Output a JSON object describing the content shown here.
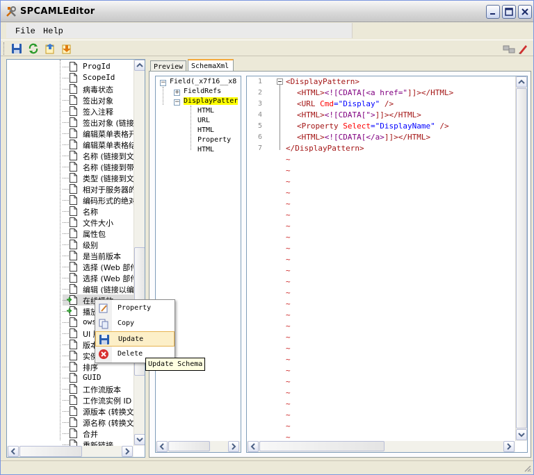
{
  "window": {
    "title": "SPCAMLEditor"
  },
  "menu": {
    "file": "File",
    "help": "Help"
  },
  "left_tree": {
    "items": [
      "ProgId",
      "ScopeId",
      "病毒状态",
      "签出对象",
      "签入注释",
      "签出对象 (链接到",
      "编辑菜单表格开",
      "编辑菜单表格结",
      "名称 (链接到文",
      "名称 (链接到带",
      "类型 (链接到文",
      "相对于服务器的",
      "编码形式的绝对",
      "名称",
      "文件大小",
      "属性包",
      "级别",
      "是当前版本",
      "选择 (Web 部件)",
      "选择 (Web 部件)",
      "编辑 (链接以编",
      "在线播放",
      "播放",
      "owsh",
      "UI 版",
      "版本",
      "实例",
      "排序",
      "GUID",
      "工作流版本",
      "工作流实例 ID",
      "源版本 (转换文",
      "源名称 (转换文",
      "合并",
      "重新链接"
    ]
  },
  "tabs": {
    "preview": "Preview",
    "schema": "SchemaXml"
  },
  "schema_tree": {
    "root": "Field(_x7f16__x8",
    "fieldrefs": "FieldRefs",
    "displaypattern": "DisplayPatter",
    "children": [
      "HTML",
      "URL",
      "HTML",
      "Property",
      "HTML"
    ]
  },
  "editor": {
    "line_numbers": [
      "1",
      "2",
      "3",
      "4",
      "5",
      "6",
      "7"
    ],
    "line1": {
      "tag": "<DisplayPattern>"
    },
    "line2": {
      "open": "<HTML>",
      "cdata": "<![CDATA[",
      "val": "<a href=\"",
      "close": "]]></HTML>"
    },
    "line3": {
      "open": "<URL ",
      "attr": "Cmd",
      "eq": "=",
      "str": "\"Display\"",
      "close": " />"
    },
    "line4": {
      "open": "<HTML>",
      "cdata": "<![CDATA[",
      "val": "\">",
      "close": "]]></HTML>"
    },
    "line5": {
      "open": "<Property ",
      "attr": "Select",
      "eq": "=",
      "str": "\"DisplayName\"",
      "close": " />"
    },
    "line6": {
      "open": "<HTML>",
      "cdata": "<![CDATA[",
      "val": "</a>",
      "close": "]]></HTML>"
    },
    "line7": {
      "tag": "</DisplayPattern>"
    },
    "tilde": "~"
  },
  "context_menu": {
    "items": [
      "Property",
      "Copy",
      "Update",
      "Delete"
    ],
    "highlighted": "Update"
  },
  "tooltip": {
    "text": "Update Schema"
  },
  "colors": {
    "accent": "#f4a83a",
    "highlight": "#ffff00",
    "tag": "#a31515",
    "bracket": "#0000ff",
    "attr": "#ff0000",
    "cdata": "#800080"
  }
}
